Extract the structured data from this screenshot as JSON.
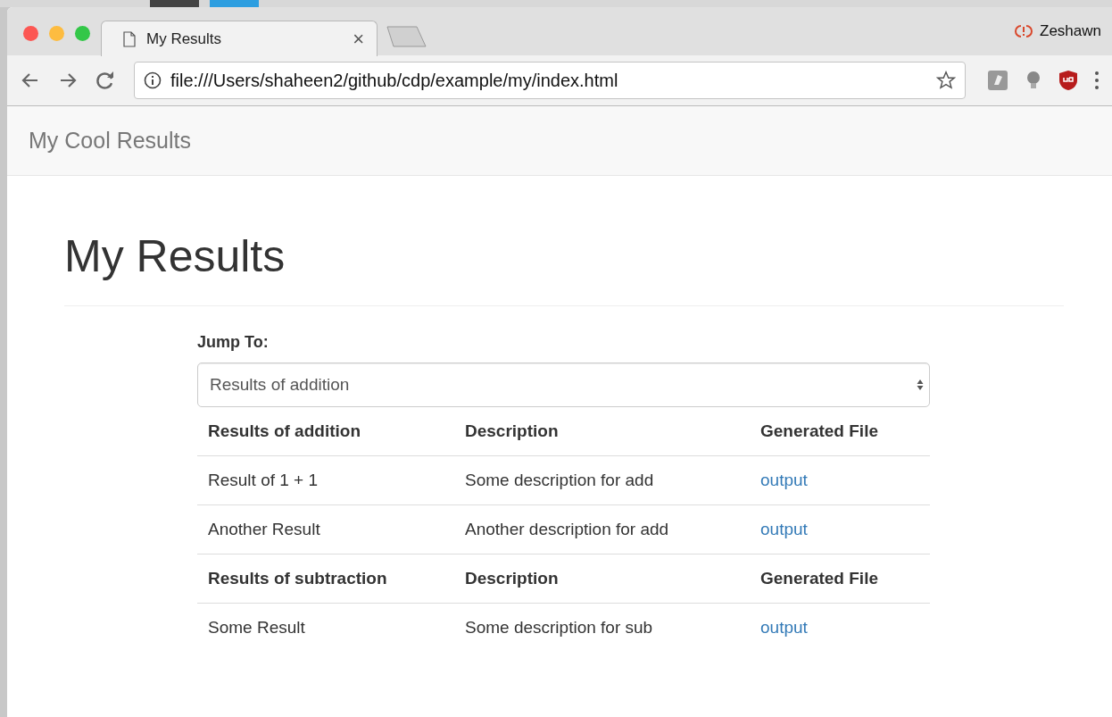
{
  "browser": {
    "tab": {
      "title": "My Results",
      "close": "×"
    },
    "profile": "Zeshawn",
    "address": "file:///Users/shaheen2/github/cdp/example/my/index.html"
  },
  "navbar": {
    "brand": "My Cool Results"
  },
  "page": {
    "heading": "My Results",
    "jump": {
      "label": "Jump To:",
      "value": "Results of addition"
    }
  },
  "table": {
    "rows": [
      {
        "kind": "heading",
        "cells": [
          "Results of addition",
          "Description",
          "Generated File"
        ]
      },
      {
        "kind": "data",
        "cells": [
          "Result of 1 + 1",
          "Some description for add",
          "output"
        ]
      },
      {
        "kind": "data",
        "cells": [
          "Another Result",
          "Another description for add",
          "output"
        ]
      },
      {
        "kind": "heading",
        "cells": [
          "Results of subtraction",
          "Description",
          "Generated File"
        ]
      },
      {
        "kind": "data",
        "cells": [
          "Some Result",
          "Some description for sub",
          "output"
        ]
      }
    ]
  }
}
